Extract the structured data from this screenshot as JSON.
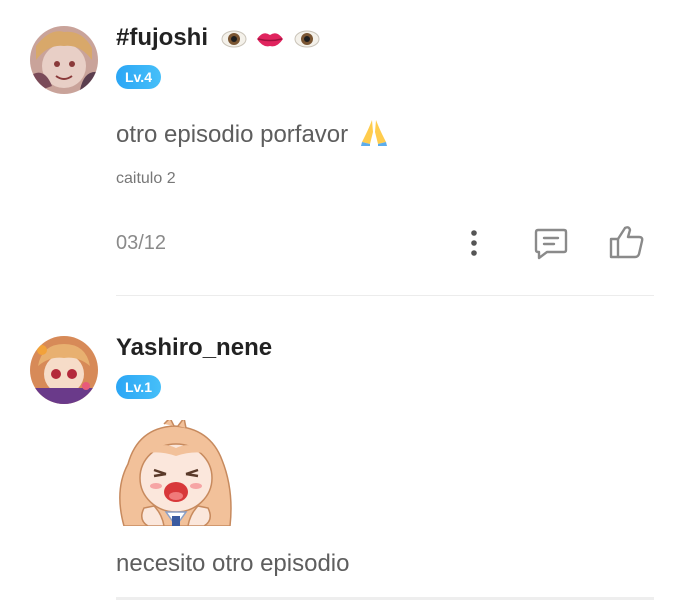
{
  "comments": [
    {
      "username": "#fujoshi",
      "username_emojis": [
        "eye-icon",
        "lips-icon",
        "eye-icon"
      ],
      "level": "Lv.4",
      "text": "otro episodio porfavor",
      "text_emoji": "folded-hands-icon",
      "chapter_ref": "caitulo 2",
      "date": "03/12",
      "actions": [
        "more-options-icon",
        "reply-comment-icon",
        "like-thumb-icon"
      ]
    },
    {
      "username": "Yashiro_nene",
      "level": "Lv.1",
      "sticker": "anime-girl-crying-sticker",
      "text": "necesito otro episodio"
    }
  ],
  "colors": {
    "level_badge": "#2ba6f5",
    "username": "#222222",
    "body_text": "#5e5e5e",
    "meta_text": "#8a8a8a",
    "icon": "#8a8a8a"
  }
}
